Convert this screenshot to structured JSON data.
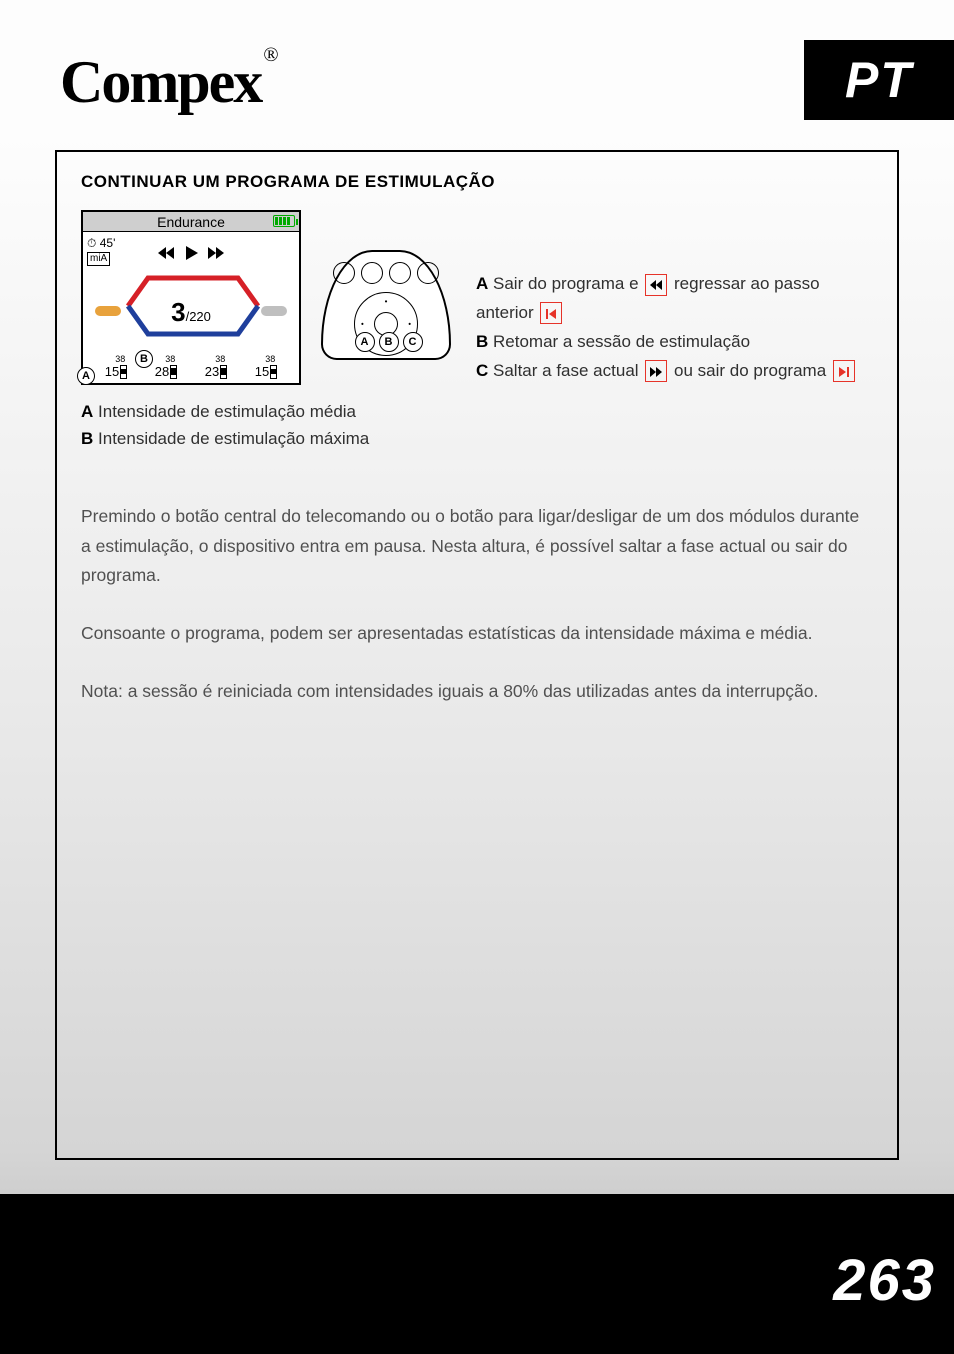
{
  "brand": "Compex",
  "brand_reg": "®",
  "lang_tag": "PT",
  "section_title": "CONTINUAR UM PROGRAMA DE ESTIMULAÇÃO",
  "device": {
    "program_name": "Endurance",
    "duration": "45'",
    "mia": "miA",
    "center_value": "3",
    "center_denom": "/220",
    "bars": [
      {
        "top": "38",
        "val": "15"
      },
      {
        "top": "38",
        "val": "28"
      },
      {
        "top": "38",
        "val": "23"
      },
      {
        "top": "38",
        "val": "15"
      }
    ]
  },
  "callouts": {
    "A": "A",
    "B": "B",
    "C": "C"
  },
  "legend_screen": {
    "A_label": "A",
    "A_text": "Intensidade de estimulação média",
    "B_label": "B",
    "B_text": "Intensidade de estimulação máxima"
  },
  "legend_remote": {
    "A_label": "A",
    "A_text1": "Sair do programa e",
    "A_text2": "regressar ao passo anterior",
    "B_label": "B",
    "B_text": "Retomar a sessão de estimulação",
    "C_label": "C",
    "C_text1": "Saltar a fase actual",
    "C_text2": "ou sair do programa"
  },
  "paragraphs": [
    "Premindo o botão central do telecomando ou o botão para ligar/desligar de um dos módulos durante a estimulação, o dispositivo entra em pausa. Nesta altura, é possível saltar a fase actual ou sair do programa.",
    "Consoante o programa, podem ser apresentadas estatísticas da intensidade máxima e média.",
    "Nota: a sessão é reiniciada com intensidades iguais a 80% das utilizadas antes da interrupção."
  ],
  "page_number": "263"
}
